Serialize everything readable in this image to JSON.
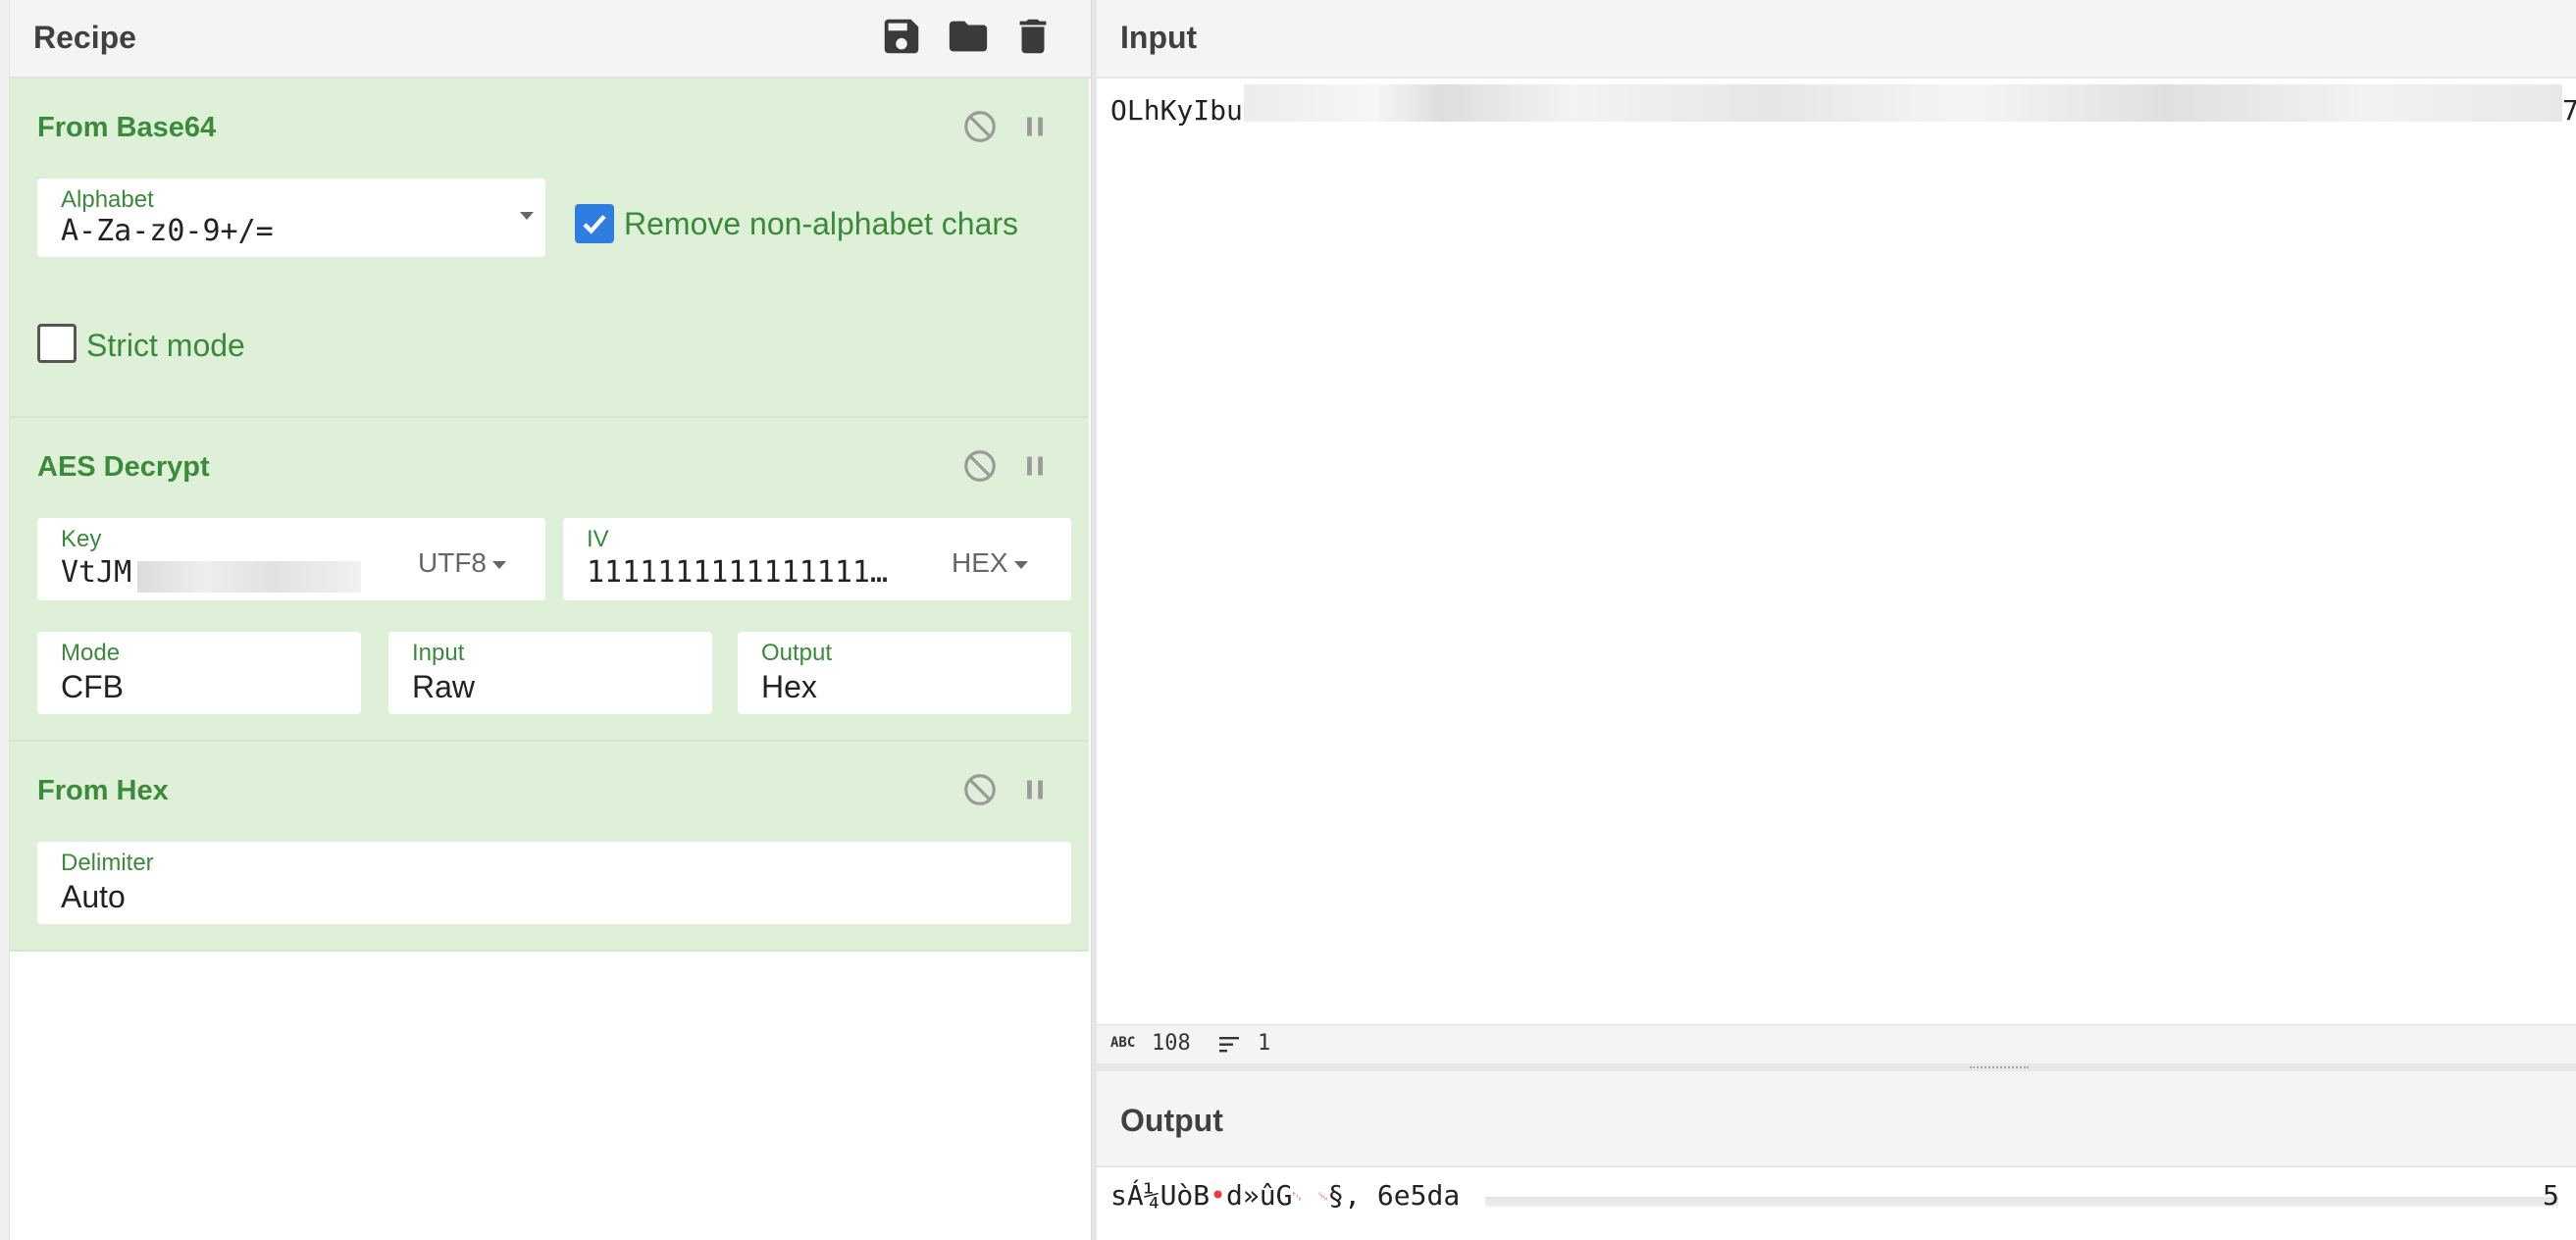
{
  "recipe": {
    "title": "Recipe",
    "operations": {
      "from_base64": {
        "title": "From Base64",
        "alphabet_label": "Alphabet",
        "alphabet_value": "A-Za-z0-9+/=",
        "remove_non_alphabet_label": "Remove non-alphabet chars",
        "remove_non_alphabet_checked": true,
        "strict_mode_label": "Strict mode",
        "strict_mode_checked": false
      },
      "aes_decrypt": {
        "title": "AES Decrypt",
        "key_label": "Key",
        "key_value": "VtJM",
        "key_encoding": "UTF8",
        "iv_label": "IV",
        "iv_value": "1111111111111111…",
        "iv_encoding": "HEX",
        "mode_label": "Mode",
        "mode_value": "CFB",
        "input_label": "Input",
        "input_value": "Raw",
        "output_label": "Output",
        "output_value": "Hex"
      },
      "from_hex": {
        "title": "From Hex",
        "delimiter_label": "Delimiter",
        "delimiter_value": "Auto"
      }
    },
    "icons": [
      "save-icon",
      "folder-icon",
      "trash-icon",
      "disable-icon",
      "pause-icon"
    ]
  },
  "input": {
    "title": "Input",
    "text_visible": "OLhKyIbu",
    "text_tail": "7",
    "status": {
      "char_count": "108",
      "line_count": "1",
      "abc_label": "ABC"
    }
  },
  "output": {
    "title": "Output",
    "text_prefix": "sÁ¼UòB",
    "text_mid1": "d»ûG",
    "text_mid2": "§, 6e5da",
    "text_tail": "5"
  },
  "colors": {
    "op_background": "#dff0d8",
    "op_title": "#3c8a3c",
    "checkbox_on": "#2f7de1",
    "control_char": "#e04040"
  }
}
